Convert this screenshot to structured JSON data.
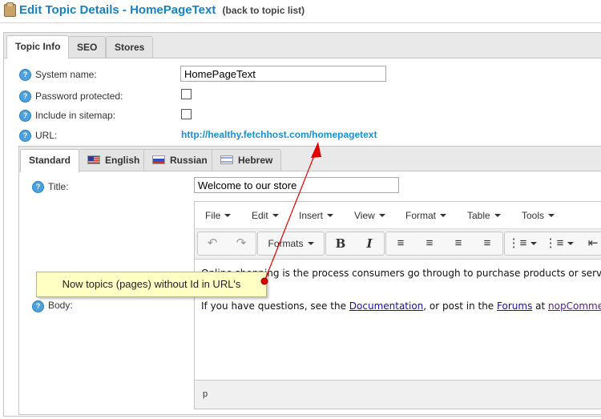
{
  "header": {
    "title": "Edit Topic Details - HomePageText",
    "back_link": "(back to topic list)"
  },
  "outer_tabs": [
    "Topic Info",
    "SEO",
    "Stores"
  ],
  "form": {
    "system_name_label": "System name:",
    "system_name_value": "HomePageText",
    "password_label": "Password protected:",
    "password_checked": false,
    "sitemap_label": "Include in sitemap:",
    "sitemap_checked": false,
    "url_label": "URL:",
    "url_value": "http://healthy.fetchhost.com/homepagetext"
  },
  "inner_tabs": [
    {
      "label": "Standard",
      "icon": "none"
    },
    {
      "label": "English",
      "icon": "us-flag-icon"
    },
    {
      "label": "Russian",
      "icon": "ru-flag-icon"
    },
    {
      "label": "Hebrew",
      "icon": "il-flag-icon"
    }
  ],
  "standard": {
    "title_label": "Title:",
    "title_value": "Welcome to our store",
    "body_label": "Body:"
  },
  "editor": {
    "menus": [
      "File",
      "Insert",
      "View",
      "Format",
      "Table",
      "Tools",
      "Edit"
    ],
    "formats_label": "Formats",
    "line1": "Online shopping is the process consumers go through to purchase products or services",
    "line2_prefix": "If you have questions, see the",
    "line2_link1": "Documentation",
    "line2_mid": ", or post in the",
    "line2_link2": "Forums",
    "line2_at": "at",
    "line2_link3": "nopCommerce.",
    "status": "p"
  },
  "callout": {
    "text": "Now topics (pages) without Id in URL's"
  },
  "colors": {
    "accent": "#1b7fbd",
    "url": "#1b90d0",
    "callout_bg": "#ffffc4",
    "arrow": "#e00000"
  }
}
